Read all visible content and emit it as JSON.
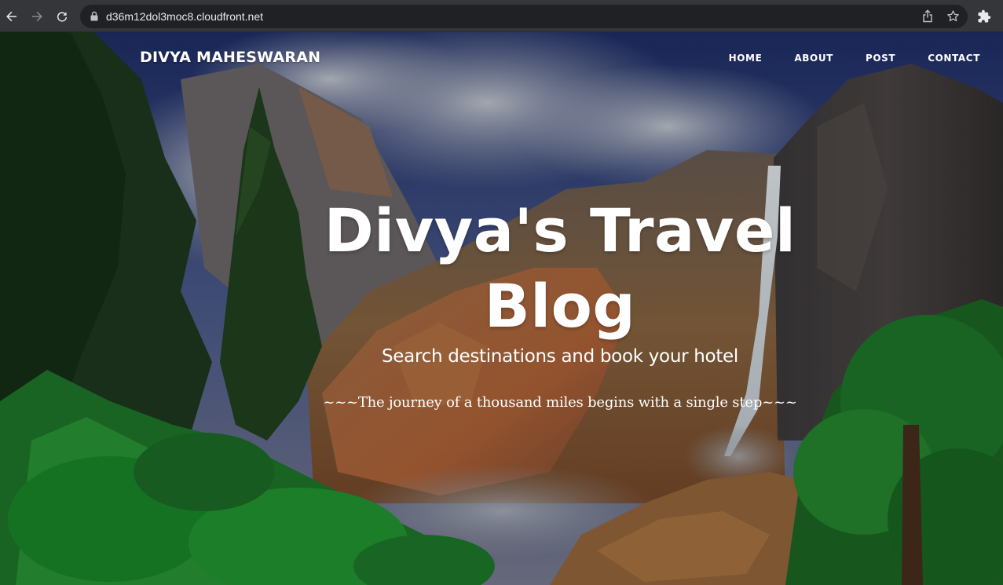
{
  "browser": {
    "url": "d36m12dol3moc8.cloudfront.net",
    "back_icon": "arrow-left-icon",
    "forward_icon": "arrow-right-icon",
    "reload_icon": "reload-icon",
    "lock_icon": "lock-icon",
    "share_icon": "share-icon",
    "bookmark_icon": "star-icon",
    "extensions_icon": "puzzle-icon"
  },
  "site": {
    "title": "DIVYA MAHESWARAN",
    "nav": [
      {
        "label": "HOME"
      },
      {
        "label": "ABOUT"
      },
      {
        "label": "POST"
      },
      {
        "label": "CONTACT"
      }
    ]
  },
  "hero": {
    "heading_line1": "Divya's Travel",
    "heading_line2": "Blog",
    "subheading": "Search destinations and book your hotel",
    "quote": "~~~The journey of a thousand miles begins with a single step~~~",
    "colors": {
      "text": "#ffffff",
      "overlay": "#000000"
    }
  }
}
